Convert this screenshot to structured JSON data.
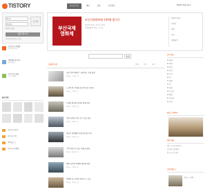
{
  "brand": {
    "name": "TISTORY",
    "accent": "#f26522"
  },
  "nav": {
    "tabs": [
      "티스토리 홈",
      "세팅",
      "포럼",
      "스킨미미"
    ]
  },
  "top_right": {
    "label": "Daum 커뮤니티 ▾"
  },
  "login": {
    "id_placeholder": "아이디",
    "pw_placeholder": "비밀번호",
    "button": "로그인",
    "remember": "아이디 저장",
    "signup_button": "회원가입 하기",
    "signup_hint": "아이디/비밀번호 찾기"
  },
  "side_promos": [
    {
      "title": "티스토리 초대장",
      "sub": "받으러 가기"
    },
    {
      "title": "@Tistory.com",
      "sub": "공지사항"
    },
    {
      "title": "티스토리 포럼",
      "sub": "모두 함께"
    }
  ],
  "side_section_title": "블로거들",
  "side_links": [
    "티스토리 소식",
    "티스토리 팁",
    "라이프로그",
    "티스토리 이벤트"
  ],
  "featured": {
    "badge_text": "부산국제영화제",
    "headline": "부산국제영화제 100배 즐기기",
    "desc_lines": [
      "영화의 바다로 떠나는 여행",
      "국제영화제 관련 글 모음"
    ],
    "right_items": [
      "Open Java",
      "디자인",
      "여행",
      "사진",
      "세계음식"
    ]
  },
  "search": {
    "placeholder": "",
    "button": "검색"
  },
  "feed": {
    "tab_label": "오늘의 추천",
    "subtabs": [
      "전체",
      "인기",
      "최신"
    ],
    "items": [
      {
        "title": "가을 산책 이야기 : 깊어가는 가을 풍경",
        "meta": "blog · 1시간 전"
      },
      {
        "title": "도시의 밤 거리를 걸으며 남긴 기록들",
        "meta": "blog · 2시간 전"
      },
      {
        "title": "오래된 성곽과 골목길 여행 사진",
        "meta": "blog · 3시간 전"
      },
      {
        "title": "주말 나들이 추천 코스 모음 정리",
        "meta": "blog · 4시간 전"
      },
      {
        "title": "바닷가 마을에서 보낸 하루의 기억",
        "meta": "blog · 5시간 전"
      },
      {
        "title": "흑백 사진으로 담은 일상 풍경들",
        "meta": "blog · 6시간 전"
      },
      {
        "title": "새벽 강가의 안개와 물안개 사진",
        "meta": "blog · 7시간 전"
      },
      {
        "title": "카메라 들고 떠난 여행 노트 모음",
        "meta": "blog · 8시간 전"
      }
    ]
  },
  "right": {
    "section1_title": "인기 태그",
    "tags": [
      "영화",
      "여행",
      "사진",
      "음악",
      "요리",
      "책",
      "게임",
      "IT",
      "일상",
      "스포츠",
      "패션",
      "자동차",
      "건강"
    ],
    "section2_title": "블로그 이야기",
    "section3_title": "최신 댓글",
    "comment_lines": [
      "좋은 글 감사합니다",
      "사진이 멋지네요",
      "잘 보고 갑니다"
    ],
    "section4_title": "추천 블로그",
    "blog_name": "블로그 소개"
  }
}
